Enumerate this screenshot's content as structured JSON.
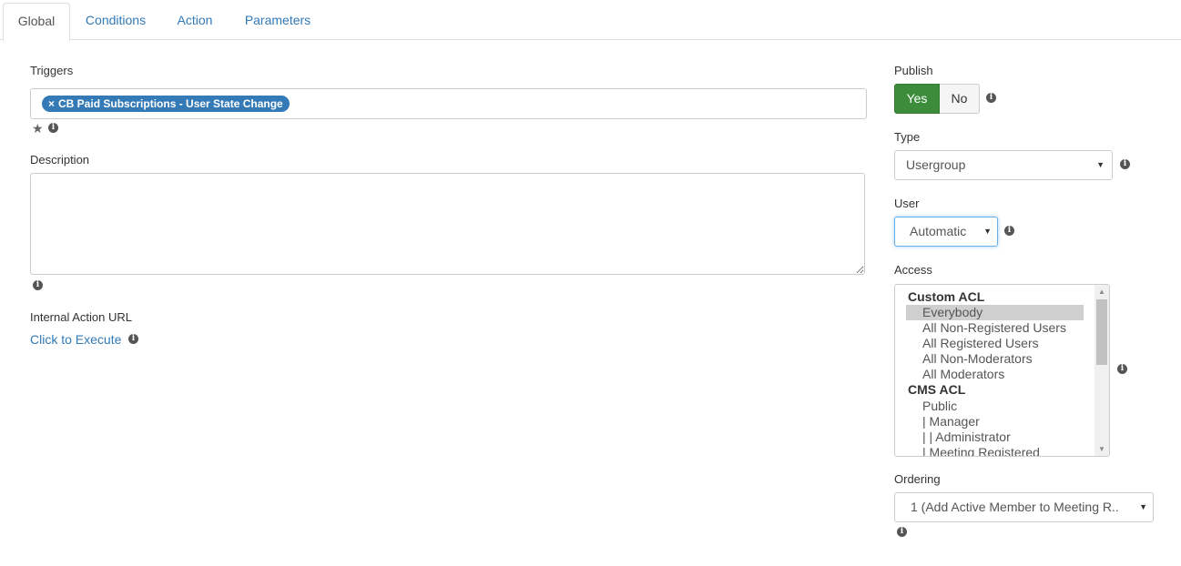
{
  "tabs": [
    "Global",
    "Conditions",
    "Action",
    "Parameters"
  ],
  "triggers": {
    "label": "Triggers",
    "tag_remove": "×",
    "tag": "CB Paid Subscriptions - User State Change"
  },
  "description": {
    "label": "Description",
    "value": ""
  },
  "internal_url": {
    "label": "Internal Action URL",
    "link": "Click to Execute"
  },
  "publish": {
    "label": "Publish",
    "yes": "Yes",
    "no": "No",
    "selected": "Yes"
  },
  "type": {
    "label": "Type",
    "value": "Usergroup"
  },
  "user": {
    "label": "User",
    "value": "Automatic"
  },
  "access": {
    "label": "Access",
    "items": [
      {
        "text": "Custom ACL",
        "group": true
      },
      {
        "text": "Everybody",
        "selected": true
      },
      {
        "text": "All Non-Registered Users"
      },
      {
        "text": "All Registered Users"
      },
      {
        "text": "All Non-Moderators"
      },
      {
        "text": "All Moderators"
      },
      {
        "text": "CMS ACL",
        "group": true
      },
      {
        "text": "Public"
      },
      {
        "text": "| Manager"
      },
      {
        "text": "| | Administrator"
      },
      {
        "text": "| Meeting Registered"
      }
    ]
  },
  "ordering": {
    "label": "Ordering",
    "value": "1 (Add Active Member to Meeting R.."
  },
  "icons": {
    "info": "i",
    "star": "★",
    "caret": "▼",
    "scroll_up": "▲",
    "scroll_down": "▼"
  }
}
